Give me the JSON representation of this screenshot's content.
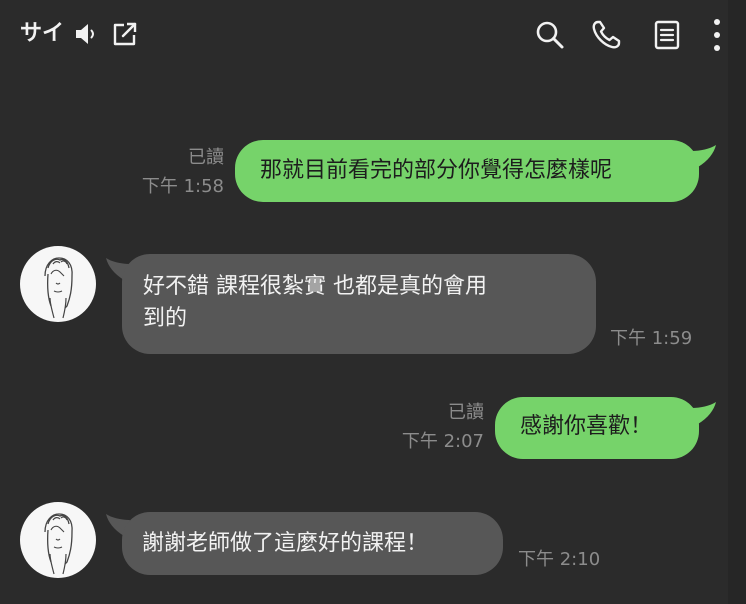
{
  "header": {
    "title": "サイ",
    "icons": {
      "mute": "speaker-muted-icon",
      "popout": "external-window-icon",
      "search": "search-icon",
      "call": "phone-icon",
      "notes": "notes-icon",
      "more": "more-vertical-icon"
    }
  },
  "colors": {
    "background": "#2b2b2b",
    "outgoing_bubble": "#76d36a",
    "incoming_bubble": "#575757",
    "meta_text": "#8c8c8c"
  },
  "messages": [
    {
      "direction": "out",
      "text": "那就目前看完的部分你覺得怎麼樣呢",
      "read_label": "已讀",
      "time": "下午 1:58"
    },
    {
      "direction": "in",
      "line1": "好不錯 課程很紮實 也都是真的會用",
      "line2": "到的",
      "time": "下午 1:59"
    },
    {
      "direction": "out",
      "text": "感謝你喜歡！",
      "read_label": "已讀",
      "time": "下午 2:07"
    },
    {
      "direction": "in",
      "text": "謝謝老師做了這麼好的課程！",
      "time": "下午 2:10"
    }
  ]
}
